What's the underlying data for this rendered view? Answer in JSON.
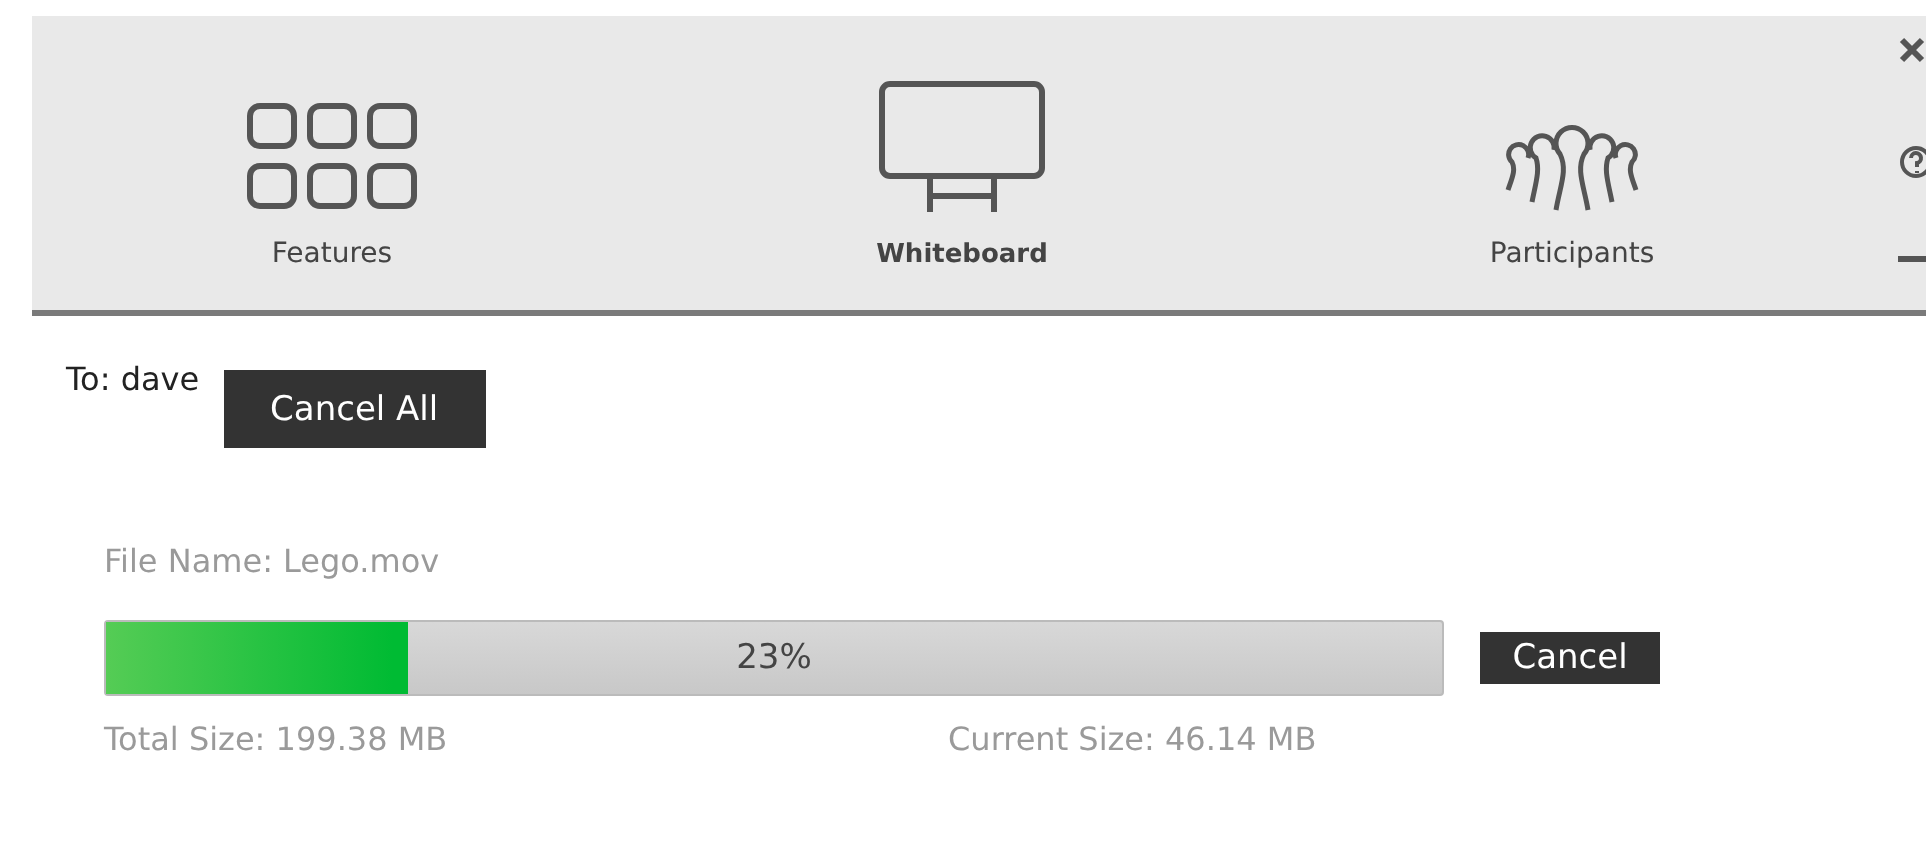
{
  "toolbar": {
    "tabs": [
      {
        "kind": "grid",
        "label": "Features",
        "selected": false
      },
      {
        "kind": "board",
        "label": "Whiteboard",
        "selected": true
      },
      {
        "kind": "people",
        "label": "Participants",
        "selected": false
      }
    ]
  },
  "transfer": {
    "recipient": "To: dave",
    "cancel_all": "Cancel All",
    "file_name": "File Name: Lego.mov",
    "progress": {
      "level": 0.226,
      "reading": "23%"
    },
    "cancel": "Cancel",
    "total_size": "Total Size: 199.38 MB",
    "current_size": "Current Size: 46.14 MB"
  }
}
